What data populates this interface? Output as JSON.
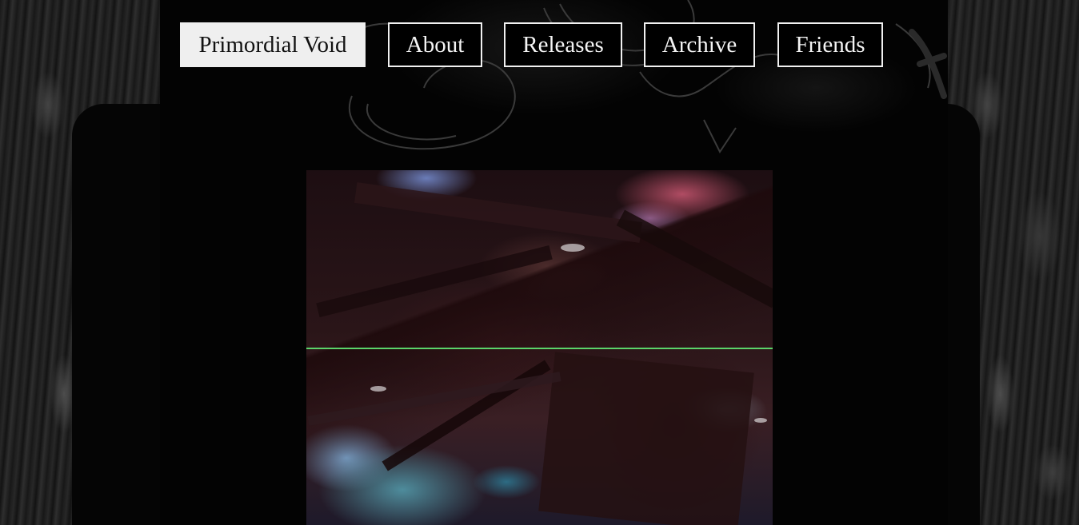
{
  "nav": {
    "items": [
      {
        "label": "Primordial Void",
        "active": true
      },
      {
        "label": "About",
        "active": false
      },
      {
        "label": "Releases",
        "active": false
      },
      {
        "label": "Archive",
        "active": false
      },
      {
        "label": "Friends",
        "active": false
      }
    ]
  },
  "colors": {
    "background": "#050505",
    "nav_border": "#f1f1f1",
    "nav_active_bg": "#efefef",
    "scanline": "#5bd46a"
  },
  "media": {
    "kind": "glitch-video-still",
    "icon": "video-frame"
  }
}
